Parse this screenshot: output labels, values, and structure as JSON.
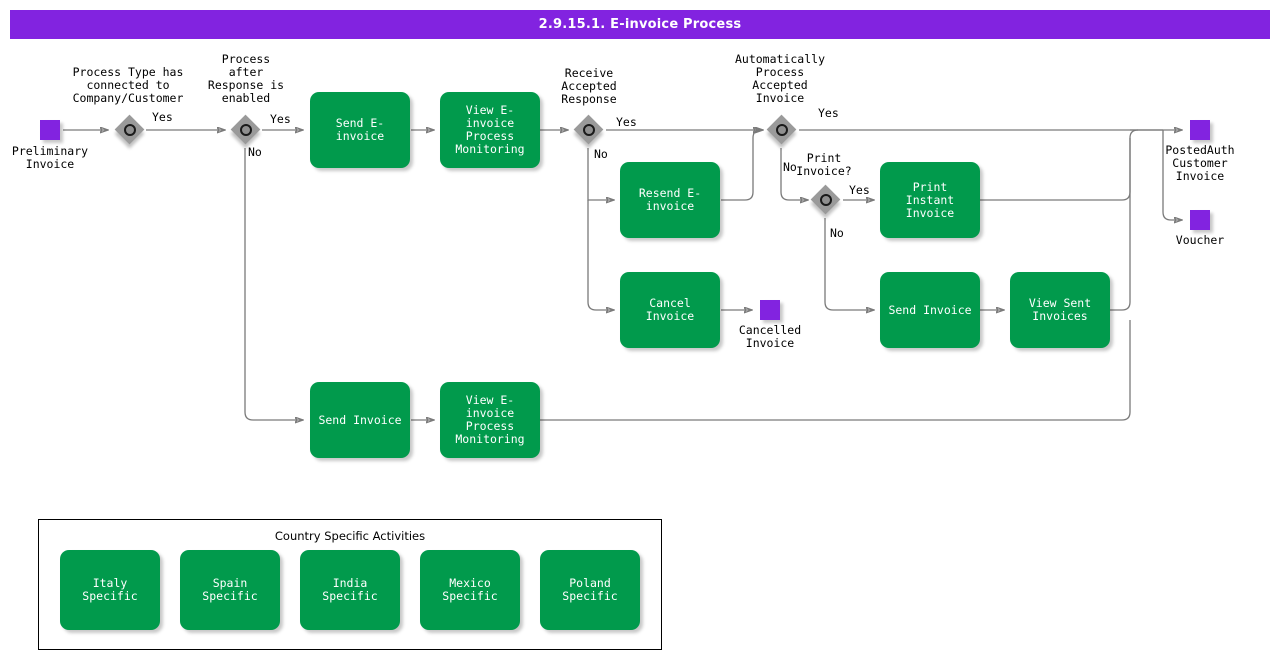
{
  "header": {
    "title": "2.9.15.1. E-invoice Process",
    "bar_color": "#8223e0",
    "text_color": "#ffffff"
  },
  "palette": {
    "activity_green": "#019a4c",
    "data_purple": "#8223e0",
    "gateway_gray": "#9a9a9a",
    "connector_gray": "#7a7a7a",
    "canvas_white": "#ffffff"
  },
  "diagram": {
    "type": "bpmn-process-flow",
    "data_objects": [
      {
        "id": "preliminary-invoice",
        "label": "Preliminary\nInvoice"
      },
      {
        "id": "cancelled-invoice",
        "label": "Cancelled\nInvoice"
      },
      {
        "id": "postedauth-customer-invoice",
        "label": "PostedAuth\nCustomer\nInvoice"
      },
      {
        "id": "voucher",
        "label": "Voucher"
      }
    ],
    "gateways": [
      {
        "id": "gw-process-type",
        "label": "Process Type has\nconnected to\nCompany/Customer"
      },
      {
        "id": "gw-process-after-response",
        "label": "Process\nafter\nResponse is\nenabled"
      },
      {
        "id": "gw-receive-accepted-response",
        "label": "Receive\nAccepted\nResponse"
      },
      {
        "id": "gw-auto-process-accepted",
        "label": "Automatically\nProcess\nAccepted\nInvoice"
      },
      {
        "id": "gw-print-invoice",
        "label": "Print\nInvoice?"
      }
    ],
    "activities": [
      {
        "id": "send-e-invoice",
        "label": "Send E-invoice"
      },
      {
        "id": "view-e-invoice-process-monitoring-top",
        "label": "View E-invoice\nProcess\nMonitoring"
      },
      {
        "id": "resend-e-invoice",
        "label": "Resend E-\ninvoice"
      },
      {
        "id": "cancel-invoice",
        "label": "Cancel Invoice"
      },
      {
        "id": "print-instant-invoice",
        "label": "Print Instant\nInvoice"
      },
      {
        "id": "send-invoice-right",
        "label": "Send Invoice"
      },
      {
        "id": "view-sent-invoices",
        "label": "View Sent\nInvoices"
      },
      {
        "id": "send-invoice-bottom",
        "label": "Send Invoice"
      },
      {
        "id": "view-e-invoice-process-monitoring-bottom",
        "label": "View E-invoice\nProcess\nMonitoring"
      }
    ],
    "flow_labels": [
      {
        "id": "yes-process-type",
        "text": "Yes"
      },
      {
        "id": "yes-process-after-response",
        "text": "Yes"
      },
      {
        "id": "no-process-after-response",
        "text": "No"
      },
      {
        "id": "yes-receive-accepted",
        "text": "Yes"
      },
      {
        "id": "no-receive-accepted",
        "text": "No"
      },
      {
        "id": "yes-auto-process",
        "text": "Yes"
      },
      {
        "id": "no-auto-process",
        "text": "No"
      },
      {
        "id": "yes-print-invoice",
        "text": "Yes"
      },
      {
        "id": "no-print-invoice",
        "text": "No"
      }
    ]
  },
  "country_group": {
    "title": "Country Specific Activities",
    "items": [
      {
        "id": "italy-specific",
        "label": "Italy Specific"
      },
      {
        "id": "spain-specific",
        "label": "Spain Specific"
      },
      {
        "id": "india-specific",
        "label": "India Specific"
      },
      {
        "id": "mexico-specific",
        "label": "Mexico Specific"
      },
      {
        "id": "poland-specific",
        "label": "Poland Specific"
      }
    ]
  }
}
